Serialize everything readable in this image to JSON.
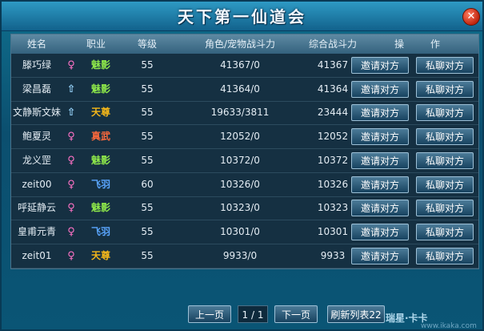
{
  "window": {
    "title": "天下第一仙道会",
    "close_glyph": "✕"
  },
  "headers": {
    "name": "姓名",
    "job": "职业",
    "level": "等级",
    "power": "角色/宠物战斗力",
    "total": "综合战斗力",
    "actions_left": "操",
    "actions_right": "作"
  },
  "job_colors": {
    "魅影": "#8ee84a",
    "天尊": "#f4b71a",
    "真武": "#ff6a3c",
    "飞羽": "#5aa6ff"
  },
  "gender_glyphs": {
    "female": "♀",
    "male": "⇧"
  },
  "rows": [
    {
      "name": "滕巧绿",
      "gender": "female",
      "job": "魅影",
      "level": "55",
      "power": "41367/0",
      "total": "41367",
      "invite": "邀请对方",
      "chat": "私聊对方"
    },
    {
      "name": "梁昌磊",
      "gender": "male",
      "job": "魅影",
      "level": "55",
      "power": "41364/0",
      "total": "41364",
      "invite": "邀请对方",
      "chat": "私聊对方"
    },
    {
      "name": "文静斯文妹",
      "gender": "male",
      "job": "天尊",
      "level": "55",
      "power": "19633/3811",
      "total": "23444",
      "invite": "邀请对方",
      "chat": "私聊对方"
    },
    {
      "name": "鲍夏灵",
      "gender": "female",
      "job": "真武",
      "level": "55",
      "power": "12052/0",
      "total": "12052",
      "invite": "邀请对方",
      "chat": "私聊对方"
    },
    {
      "name": "龙义罡",
      "gender": "female",
      "job": "魅影",
      "level": "55",
      "power": "10372/0",
      "total": "10372",
      "invite": "邀请对方",
      "chat": "私聊对方"
    },
    {
      "name": "zeit00",
      "gender": "female",
      "job": "飞羽",
      "level": "60",
      "power": "10326/0",
      "total": "10326",
      "invite": "邀请对方",
      "chat": "私聊对方"
    },
    {
      "name": "呼延静云",
      "gender": "female",
      "job": "魅影",
      "level": "55",
      "power": "10323/0",
      "total": "10323",
      "invite": "邀请对方",
      "chat": "私聊对方"
    },
    {
      "name": "皇甫元青",
      "gender": "female",
      "job": "飞羽",
      "level": "55",
      "power": "10301/0",
      "total": "10301",
      "invite": "邀请对方",
      "chat": "私聊对方"
    },
    {
      "name": "zeit01",
      "gender": "female",
      "job": "天尊",
      "level": "55",
      "power": "9933/0",
      "total": "9933",
      "invite": "邀请对方",
      "chat": "私聊对方"
    }
  ],
  "pager": {
    "prev": "上一页",
    "indicator": "1 / 1",
    "next": "下一页",
    "refresh": "刷新列表22"
  },
  "watermark": {
    "logo": "瑞星·卡卡",
    "url": "www.ikaka.com"
  }
}
